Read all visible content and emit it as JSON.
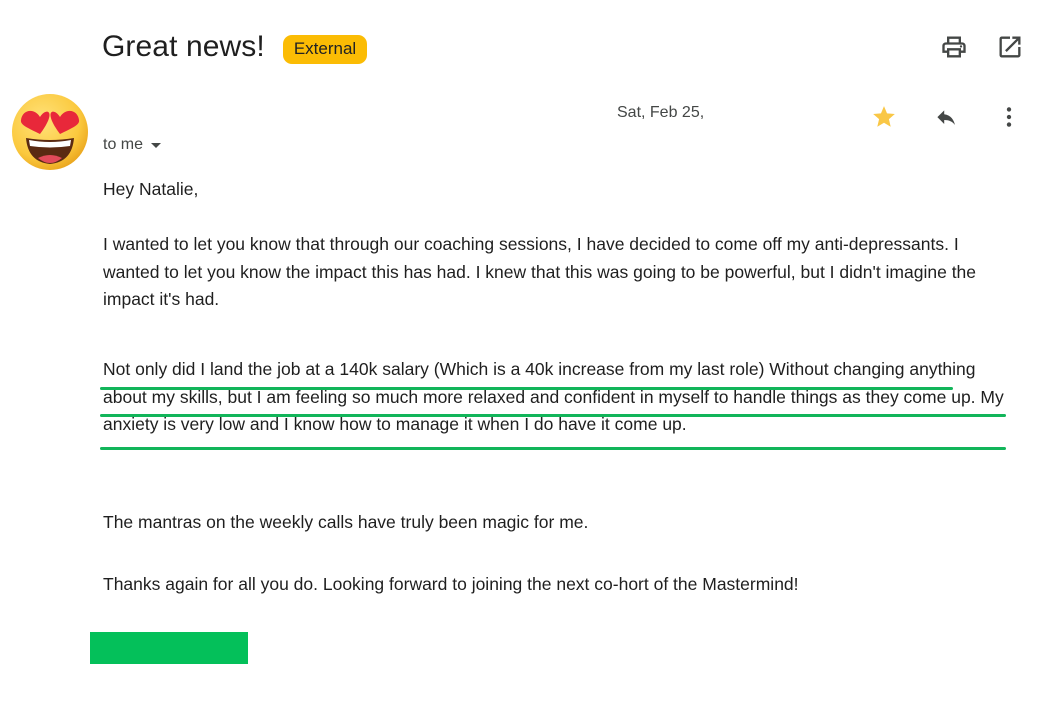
{
  "email": {
    "subject": "Great news!",
    "badge": "External",
    "date": "Sat, Feb 25,",
    "recipient": "to me",
    "greeting": "Hey Natalie,",
    "paragraphs": [
      "I wanted to let you know that through our coaching sessions, I have decided to come off my anti-depressants. I wanted to let you know the impact this has had. I knew that this was going to be powerful, but I didn't imagine the impact it's had.",
      "Not only did I land the job at a 140k salary (Which is a 40k increase from my last role) Without changing anything about my skills, but I am feeling so much more relaxed and confident in myself to handle things as they come up. My anxiety is very low and I know how to manage it when I do have it come up.",
      "The mantras on the weekly calls have truly been magic for me.",
      "Thanks again for all you do. Looking forward to joining the next co-hort of the Mastermind!"
    ]
  },
  "icons": {
    "print": "print-icon",
    "open_new_window": "open-in-new-window-icon",
    "avatar": "heart-eyes-emoji-avatar",
    "star": "star-icon",
    "reply": "reply-icon",
    "more": "more-vert-icon",
    "caret": "caret-down-icon"
  },
  "colors": {
    "badge_bg": "#fbbc04",
    "star": "#f9c746",
    "highlight_underline": "#12b55a",
    "green_block": "#04c05a"
  }
}
